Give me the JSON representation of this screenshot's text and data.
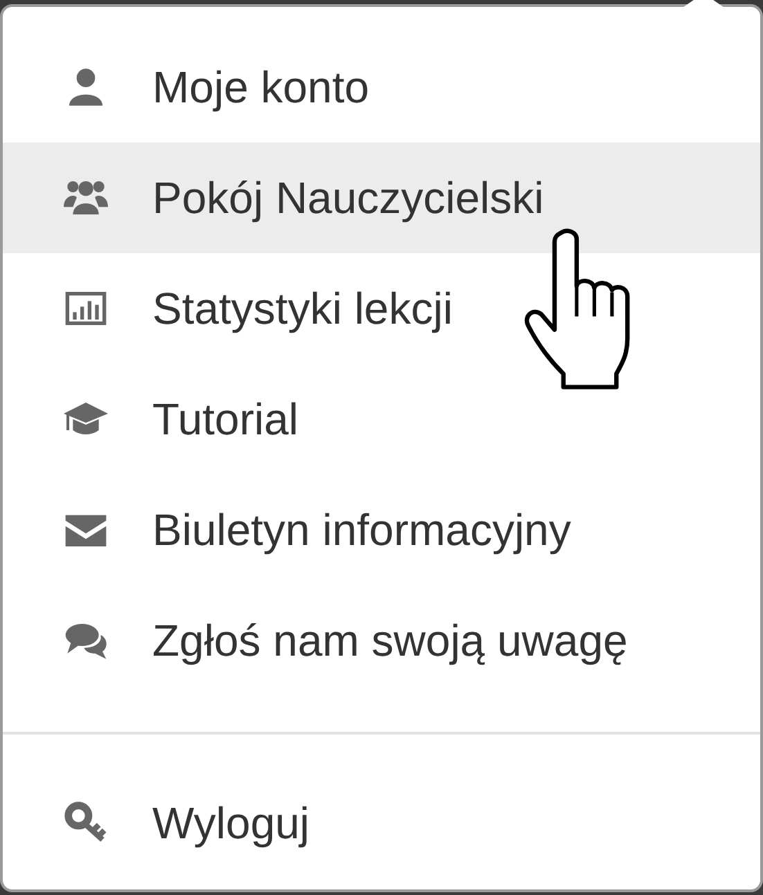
{
  "menu_sections": [
    {
      "items": [
        {
          "label": "Moje konto",
          "selected": false
        },
        {
          "label": "Pokój Nauczycielski",
          "selected": true
        },
        {
          "label": "Statystyki lekcji",
          "selected": false
        },
        {
          "label": "Tutorial",
          "selected": false
        },
        {
          "label": "Biuletyn informacyjny",
          "selected": false
        },
        {
          "label": "Zgłoś nam swoją uwagę",
          "selected": false
        }
      ]
    },
    {
      "items": [
        {
          "label": "Wyloguj",
          "selected": false
        }
      ]
    }
  ]
}
